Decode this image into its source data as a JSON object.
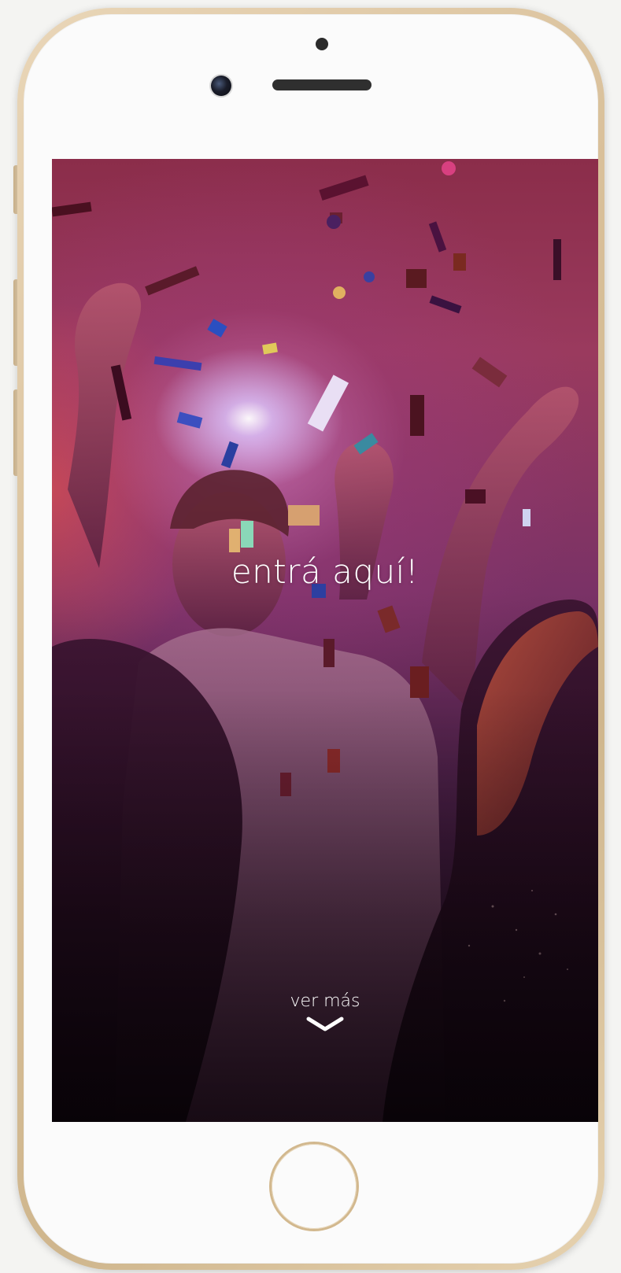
{
  "device": {
    "color_frame": "#d9c09a",
    "color_face": "#fbfbfb"
  },
  "screen": {
    "headline": "entrá aquí!",
    "more_label": "ver más",
    "more_icon": "chevron-down-icon",
    "background_image": "party-confetti-photo"
  }
}
